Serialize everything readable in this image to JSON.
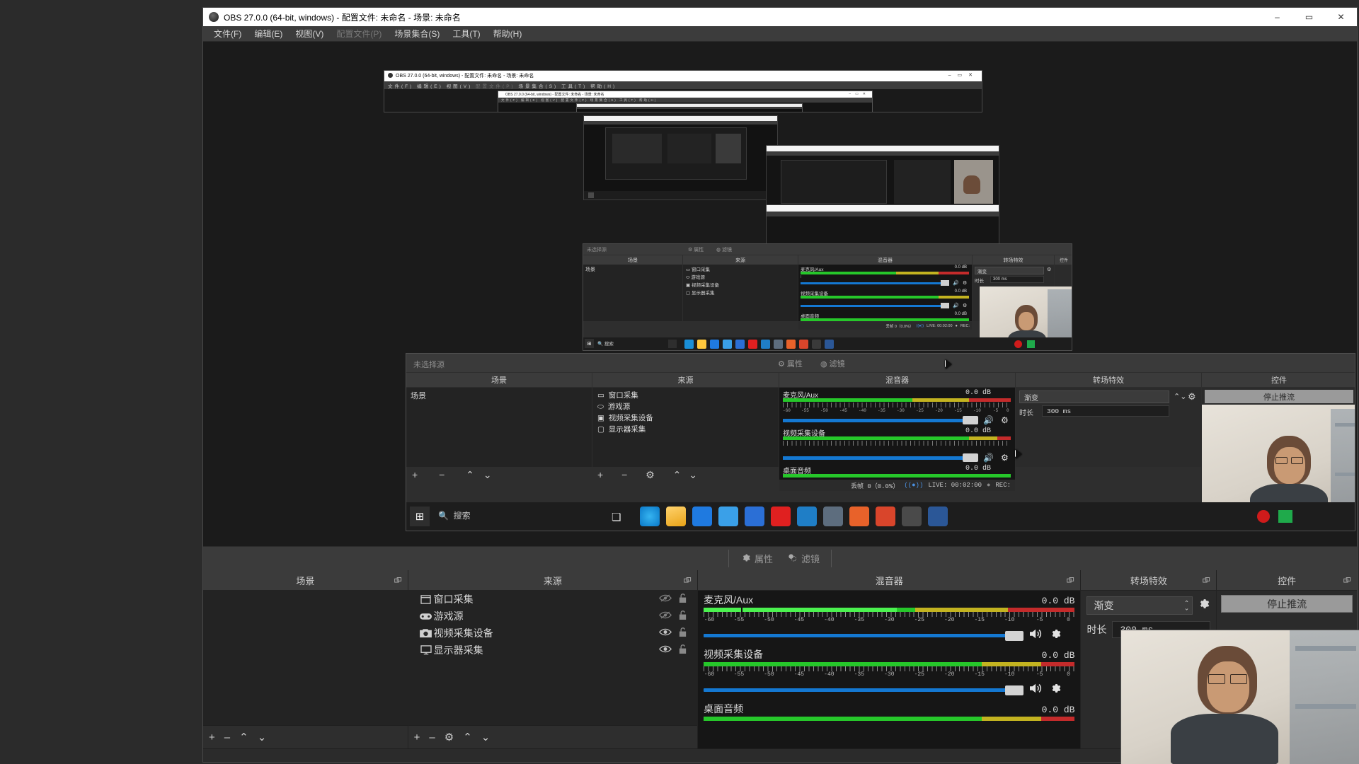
{
  "window": {
    "title": "OBS 27.0.0 (64-bit, windows) - 配置文件: 未命名 - 场景: 未命名",
    "minimize": "–",
    "maximize": "▭",
    "close": "✕"
  },
  "menu": {
    "items": [
      {
        "label": "文件(F)",
        "disabled": false
      },
      {
        "label": "编辑(E)",
        "disabled": false
      },
      {
        "label": "视图(V)",
        "disabled": false
      },
      {
        "label": "配置文件(P)",
        "disabled": true
      },
      {
        "label": "场景集合(S)",
        "disabled": false
      },
      {
        "label": "工具(T)",
        "disabled": false
      },
      {
        "label": "帮助(H)",
        "disabled": false
      }
    ]
  },
  "context_toolbar": {
    "properties": "属性",
    "filters": "滤镜",
    "properties_icon": "gear-icon",
    "filters_icon": "filters-icon"
  },
  "docks": {
    "scenes": {
      "title": "场景",
      "float_icon": "undock-icon",
      "items": [],
      "toolbar_icons": [
        "add-icon",
        "remove-icon",
        "move-up-icon",
        "move-down-icon"
      ],
      "toolbar_glyphs": [
        "+",
        "–",
        "⌃",
        "⌄"
      ]
    },
    "sources": {
      "title": "来源",
      "float_icon": "undock-icon",
      "items": [
        {
          "name": "窗口采集",
          "icon": "window-capture-icon",
          "visible": false,
          "locked": false
        },
        {
          "name": "游戏源",
          "icon": "game-capture-icon",
          "visible": false,
          "locked": false
        },
        {
          "name": "视频采集设备",
          "icon": "camera-icon",
          "visible": true,
          "locked": false
        },
        {
          "name": "显示器采集",
          "icon": "display-capture-icon",
          "visible": true,
          "locked": false
        }
      ],
      "toolbar_glyphs": [
        "+",
        "–",
        "⚙",
        "⌃",
        "⌄"
      ],
      "toolbar_icons": [
        "add-source-icon",
        "remove-source-icon",
        "source-properties-icon",
        "move-up-icon",
        "move-down-icon"
      ]
    },
    "mixer": {
      "title": "混音器",
      "float_icon": "undock-icon",
      "scale_ticks": [
        "-60",
        "-55",
        "-50",
        "-45",
        "-40",
        "-35",
        "-30",
        "-25",
        "-20",
        "-15",
        "-10",
        "-5",
        "0"
      ],
      "tracks": [
        {
          "name": "麦克风/Aux",
          "db": "0.0",
          "db_unit": "dB",
          "level_pct": 52,
          "fader_pct": 90,
          "muted": false
        },
        {
          "name": "视频采集设备",
          "db": "0.0",
          "db_unit": "dB",
          "level_pct": 0,
          "fader_pct": 90,
          "muted": false
        },
        {
          "name": "桌面音频",
          "db": "0.0",
          "db_unit": "dB",
          "level_pct": 0,
          "fader_pct": 90,
          "muted": false
        }
      ]
    },
    "transitions": {
      "title": "转场特效",
      "float_icon": "undock-icon",
      "selected": "渐变",
      "duration_label": "时长",
      "duration_value": "300 ms",
      "properties_icon": "gear-icon"
    },
    "controls": {
      "title": "控件",
      "float_icon": "undock-icon",
      "stop_stream": "停止推流"
    }
  },
  "statusbar": {
    "dropped_frames": "丢帧 0（0.0%）",
    "live_icon": "broadcast-icon",
    "live": "LIVE: 00:02:00",
    "rec": "REC:"
  },
  "taskbar": {
    "start_icon": "windows-start-icon",
    "search_icon": "search-icon",
    "search_placeholder": "搜索",
    "taskview_icon": "task-view-icon",
    "apps": [
      {
        "name": "edge-icon",
        "color": "#1a8fd8",
        "glyph": "e"
      },
      {
        "name": "file-explorer-icon",
        "color": "#ffc83d",
        "glyph": "▤"
      },
      {
        "name": "wechat-icon",
        "color": "#1f7ae0",
        "glyph": "✦"
      },
      {
        "name": "mail-icon",
        "color": "#3aa0e8",
        "glyph": "✉"
      },
      {
        "name": "lark-icon",
        "color": "#2b6fd6",
        "glyph": "L"
      },
      {
        "name": "pdf-reader-icon",
        "color": "#e02020",
        "glyph": "Ⅲ"
      },
      {
        "name": "vscode-icon",
        "color": "#1f7ec6",
        "glyph": "✖"
      },
      {
        "name": "photos-icon",
        "color": "#5d6d7e",
        "glyph": "▨"
      },
      {
        "name": "firefox-icon",
        "color": "#e8622a",
        "glyph": "F"
      },
      {
        "name": "matlab-icon",
        "color": "#d9452b",
        "glyph": "∿"
      },
      {
        "name": "obs-icon",
        "color": "#3a3a3a",
        "glyph": "◉"
      },
      {
        "name": "word-icon",
        "color": "#2b5797",
        "glyph": "W"
      }
    ],
    "tray": [
      {
        "name": "recording-indicator-icon",
        "color": "#cf1b1b",
        "glyph": "●"
      },
      {
        "name": "volume-icon",
        "color": "#d8d8d8",
        "glyph": "🔊"
      },
      {
        "name": "battery-icon",
        "color": "#1faa4b",
        "glyph": "▮"
      }
    ]
  },
  "preview": {
    "nested_depth": 6,
    "description": "recursive display-capture infinite mirror of the OBS window",
    "cursor_label": "mouse-cursor"
  },
  "colors": {
    "window_bg": "#2b2b2b",
    "dock_header": "#3b3b3b",
    "list_bg": "#232323",
    "accent_blue": "#1478d2",
    "meter_green": "#26c72a",
    "meter_yellow": "#c3b320",
    "meter_red": "#c42b2b",
    "text": "#d6d6d6"
  }
}
